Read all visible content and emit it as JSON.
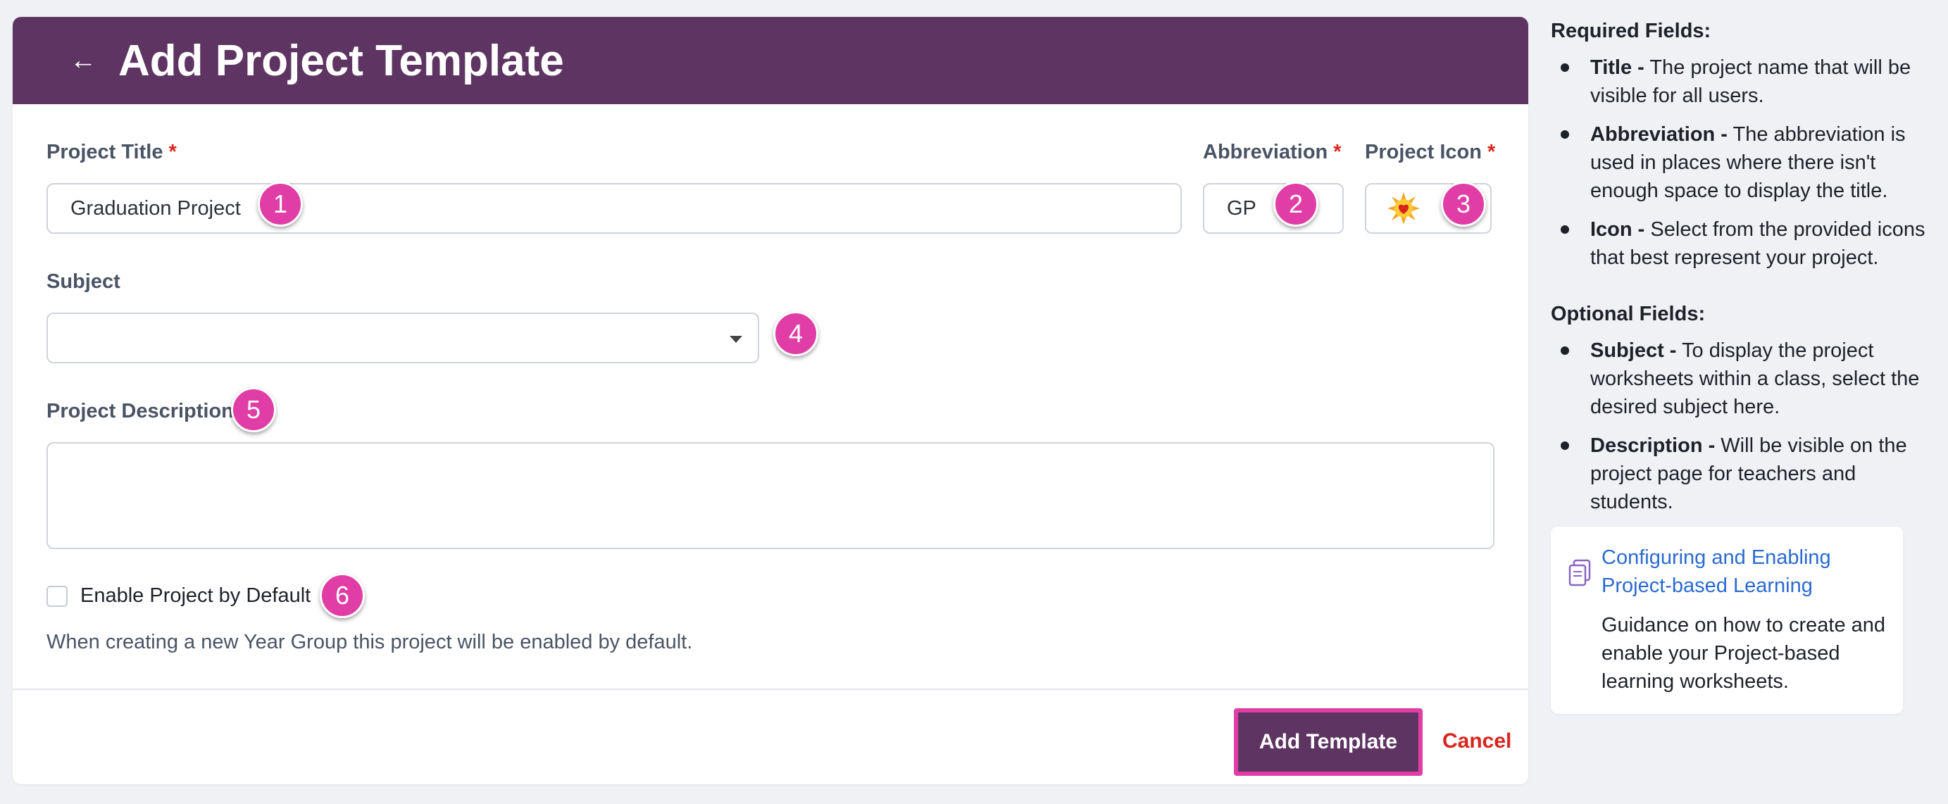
{
  "header": {
    "back_icon": "arrow-left-icon",
    "title": "Add Project Template"
  },
  "form": {
    "title_label": "Project Title",
    "title_value": "Graduation Project",
    "abbrev_label": "Abbreviation",
    "abbrev_value": "GP",
    "icon_label": "Project Icon",
    "icon_value": "sun-with-heart-icon",
    "required_mark": "*",
    "subject_label": "Subject",
    "subject_value": "",
    "description_label": "Project Description",
    "description_value": "",
    "enable_label": "Enable Project by Default",
    "enable_checked": false,
    "enable_help": "When creating a new Year Group this project will be enabled by default."
  },
  "markers": [
    "1",
    "2",
    "3",
    "4",
    "5",
    "6"
  ],
  "actions": {
    "add_label": "Add Template",
    "cancel_label": "Cancel"
  },
  "help": {
    "required_heading": "Required Fields:",
    "required_items": [
      {
        "term": "Title -",
        "text": " The project name that will be visible for all users."
      },
      {
        "term": "Abbreviation -",
        "text": " The abbreviation is used in places where there isn't enough space to display the title."
      },
      {
        "term": "Icon -",
        "text": " Select from the provided icons that best represent your project."
      }
    ],
    "optional_heading": "Optional Fields:",
    "optional_items": [
      {
        "term": "Subject -",
        "text": " To display the project worksheets within a class, select the desired subject here."
      },
      {
        "term": "Description -",
        "text": " Will be visible on the project page for teachers and students."
      }
    ],
    "link_title": "Configuring and Enabling Project-based Learning",
    "link_desc": "Guidance on how to create and enable your Project-based learning worksheets."
  },
  "colors": {
    "header_bg": "#5e3562",
    "required": "#d8261d",
    "marker": "#e13da6",
    "link": "#2a6ad0"
  }
}
